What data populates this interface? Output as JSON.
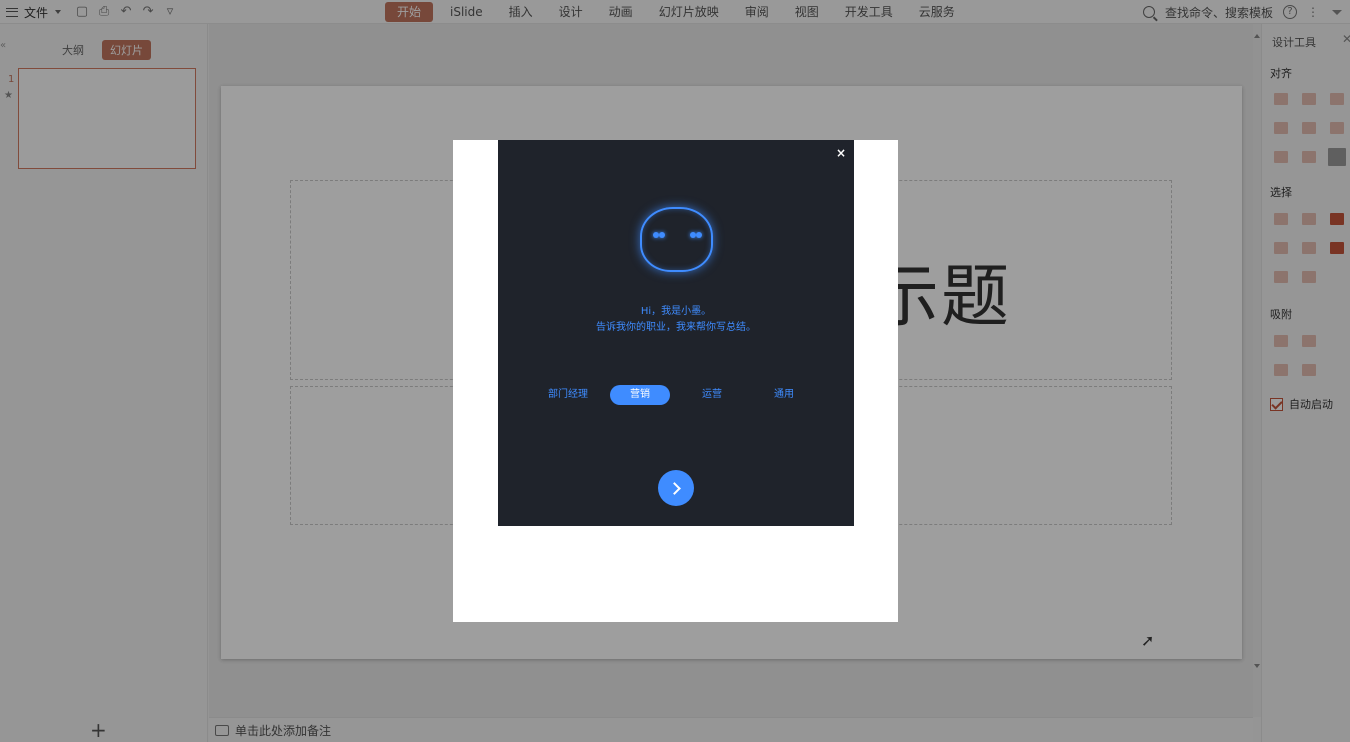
{
  "menubar": {
    "file_label": "文件",
    "tabs": [
      {
        "label": "开始",
        "active": true
      },
      {
        "label": "iSlide"
      },
      {
        "label": "插入"
      },
      {
        "label": "设计"
      },
      {
        "label": "动画"
      },
      {
        "label": "幻灯片放映"
      },
      {
        "label": "审阅"
      },
      {
        "label": "视图"
      },
      {
        "label": "开发工具"
      },
      {
        "label": "云服务"
      }
    ],
    "search_label": "查找命令、搜索模板",
    "help_glyph": "?",
    "more_glyph": "⋮",
    "icons": [
      "hamburger-icon",
      "save-icon",
      "print-icon",
      "undo-icon",
      "redo-icon",
      "customize-icon",
      "search-icon",
      "help-icon",
      "more-icon",
      "chevron-down-icon"
    ]
  },
  "leftpane": {
    "tabs": [
      {
        "label": "大纲"
      },
      {
        "label": "幻灯片",
        "active": true
      }
    ],
    "slide_number": "1",
    "slide_star": "★",
    "add_glyph": "+"
  },
  "slide": {
    "title_fragment": "示题"
  },
  "notes": {
    "placeholder": "单击此处添加备注"
  },
  "rightpanel": {
    "title": "设计工具",
    "close_glyph": "✕",
    "sections": {
      "align": "对齐",
      "select": "选择",
      "snap": "吸附"
    },
    "autostart_label": "自动启动",
    "autostart_checked": true
  },
  "dialog": {
    "close_glyph": "×",
    "greeting_line1": "Hi，我是小墨。",
    "greeting_line2": "告诉我你的职业，我来帮你写总结。",
    "options": [
      {
        "label": "部门经理"
      },
      {
        "label": "营销",
        "selected": true
      },
      {
        "label": "运营"
      },
      {
        "label": "通用"
      }
    ],
    "accent_color": "#3f8cff",
    "background_color": "#1f232b"
  },
  "colors": {
    "brand": "#c0755e",
    "accent": "#3f8cff"
  }
}
